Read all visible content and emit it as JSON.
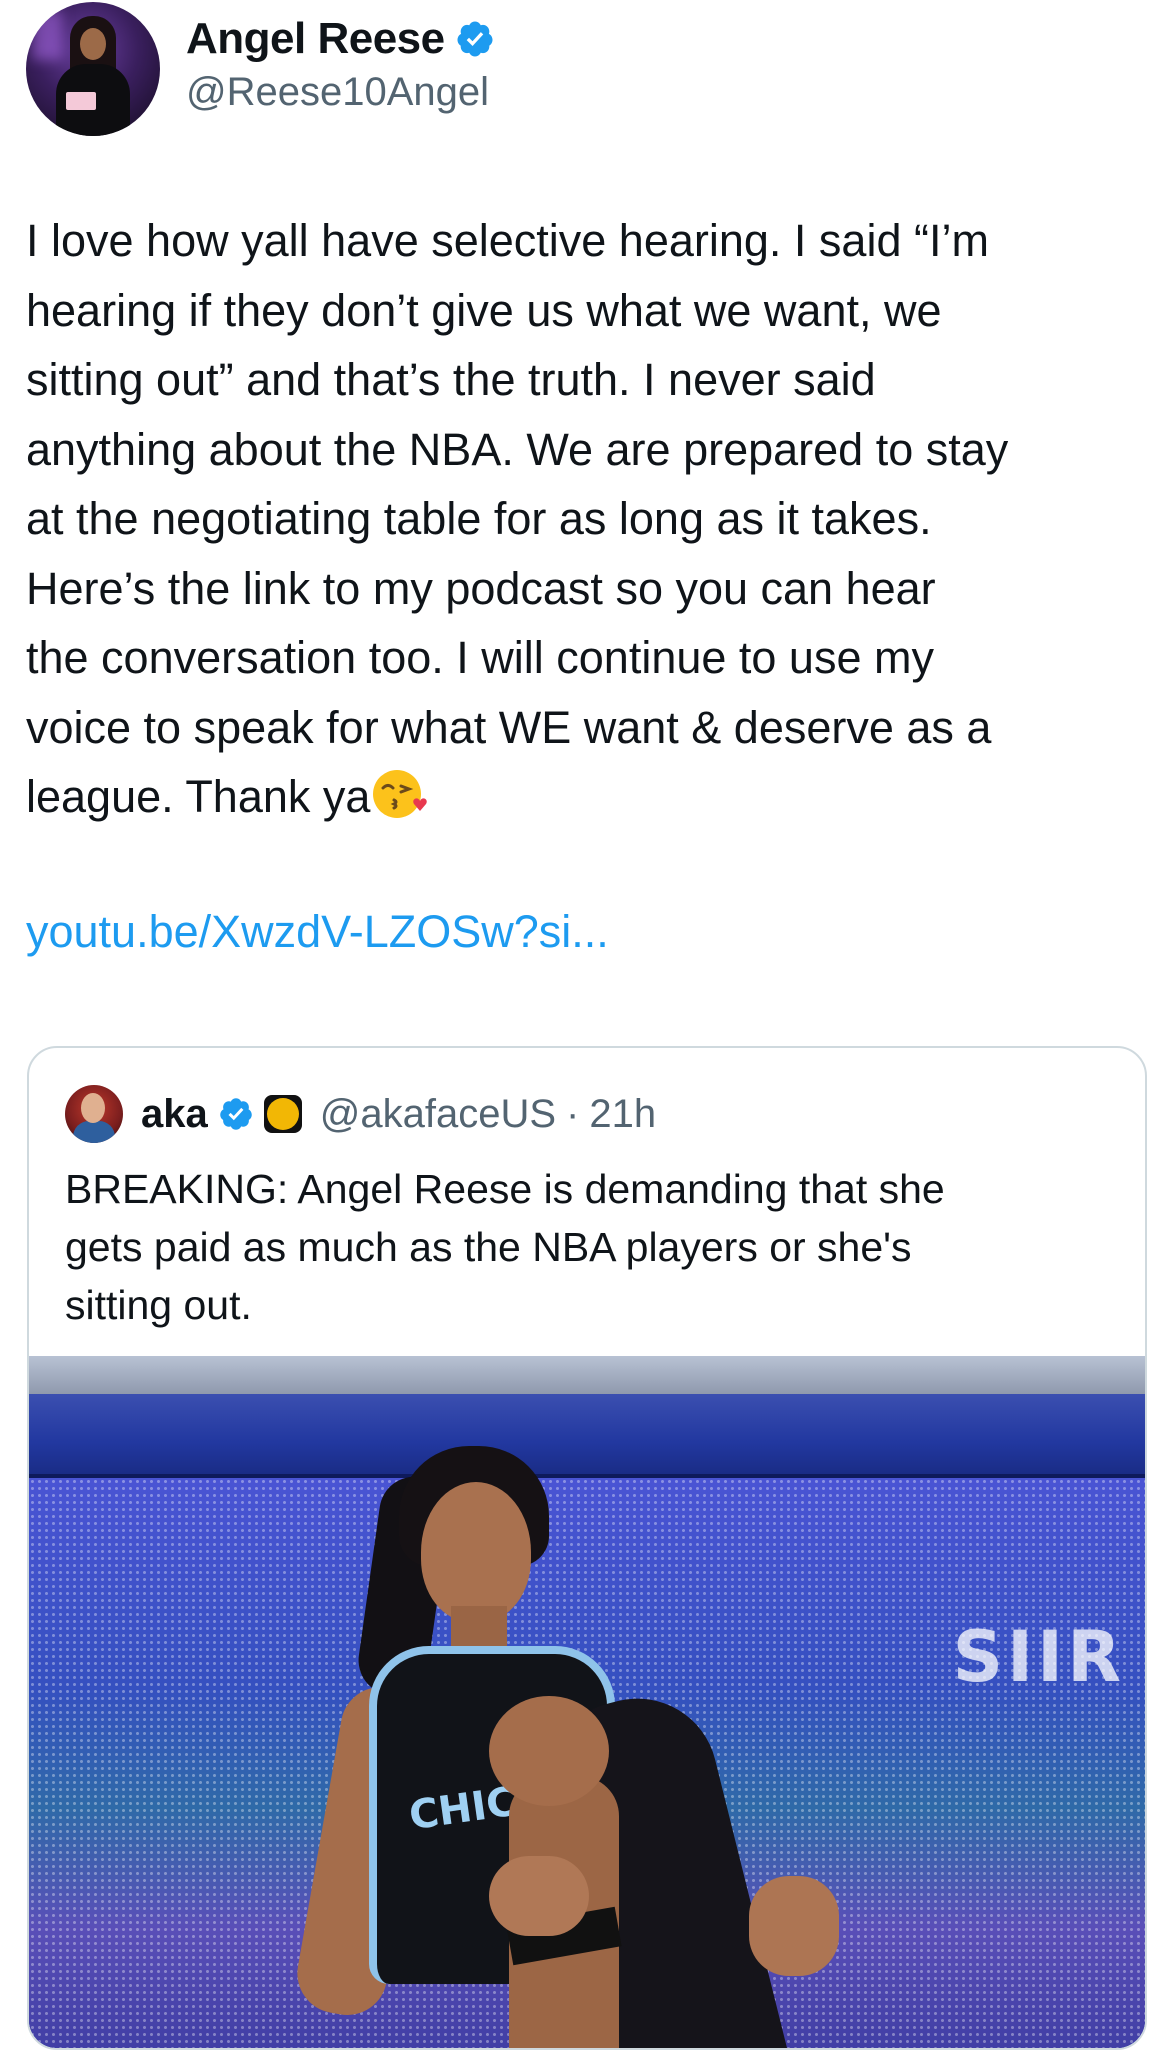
{
  "author": {
    "display_name": "Angel Reese",
    "handle": "@Reese10Angel",
    "verified": true
  },
  "tweet": {
    "text": "I love how yall have selective hearing. I said “I’m\nhearing if they don’t give us what we want, we\nsitting out” and that’s the truth. I never said\nanything about the NBA. We are prepared to stay\nat the negotiating table for as long as it takes.\nHere’s the link to my podcast so you can hear\nthe conversation too. I will continue to use my\nvoice to speak for what WE want & deserve as a\nleague. Thank ya",
    "emoji": "face-blowing-a-kiss",
    "link": "youtu.be/XwzdV-LZOSw?si..."
  },
  "quoted_tweet": {
    "display_name": "aka",
    "handle": "@akafaceUS",
    "separator": "·",
    "time": "21h",
    "verified": true,
    "badge": "gold-affiliate-badge",
    "text": "BREAKING: Angel Reese is demanding that she\ngets paid as much as the NBA players or she's\nsitting out.",
    "image": {
      "description_icon": "basketball-player-photo",
      "jersey_text": "CHIC",
      "led_text": "SIIR"
    }
  },
  "colors": {
    "link": "#1d9bf0",
    "verified": "#1d9bf0",
    "secondary_text": "#536471",
    "border": "#cfd9de"
  }
}
